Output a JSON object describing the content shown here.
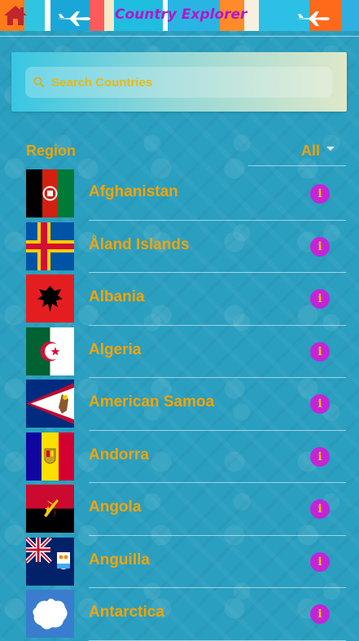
{
  "header": {
    "title": "Country Explorer",
    "home_icon": "home-icon",
    "decoration_icon": "airplane-icon"
  },
  "search": {
    "placeholder": "Search Countries",
    "value": "",
    "icon": "search-icon"
  },
  "filter": {
    "label": "Region",
    "selected": "All"
  },
  "countries": [
    {
      "name": "Afghanistan",
      "flag": "flag-afghanistan"
    },
    {
      "name": "Åland Islands",
      "flag": "flag-aland-islands"
    },
    {
      "name": "Albania",
      "flag": "flag-albania"
    },
    {
      "name": "Algeria",
      "flag": "flag-algeria"
    },
    {
      "name": "American Samoa",
      "flag": "flag-american-samoa"
    },
    {
      "name": "Andorra",
      "flag": "flag-andorra"
    },
    {
      "name": "Angola",
      "flag": "flag-angola"
    },
    {
      "name": "Anguilla",
      "flag": "flag-anguilla"
    },
    {
      "name": "Antarctica",
      "flag": "flag-antarctica"
    }
  ],
  "info_label": "i",
  "colors": {
    "background": "#2a9fc0",
    "title": "#b218c8",
    "accent_text": "#f7a300",
    "info_button": "#c424d8"
  }
}
